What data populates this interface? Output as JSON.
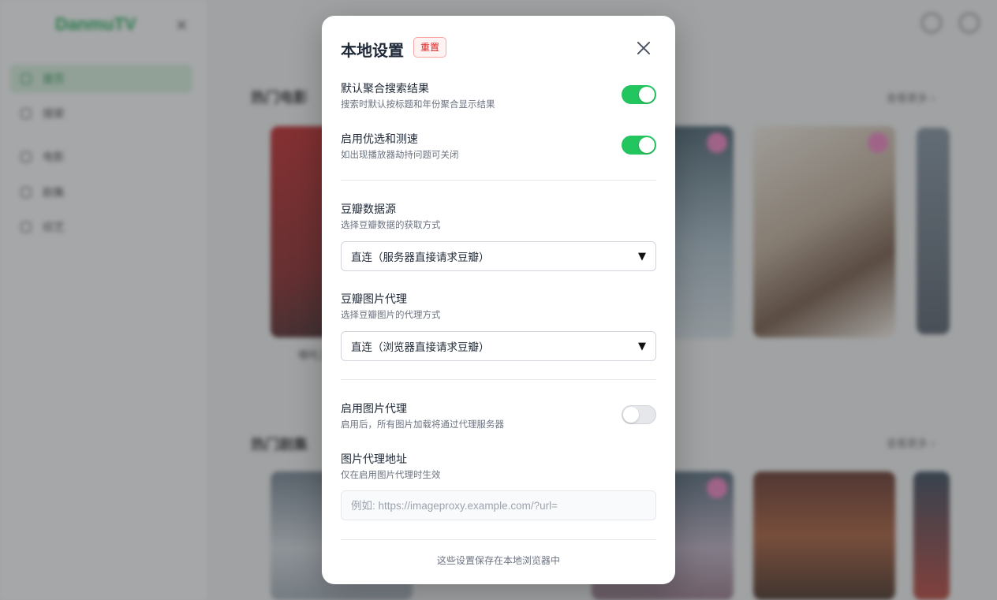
{
  "app": {
    "logo": "DanmuTV"
  },
  "sidebar": {
    "items": [
      {
        "label": "首页",
        "active": true
      },
      {
        "label": "搜索",
        "active": false
      },
      {
        "label": "电影",
        "active": false
      },
      {
        "label": "剧集",
        "active": false
      },
      {
        "label": "综艺",
        "active": false
      }
    ]
  },
  "sections": {
    "movies": {
      "title": "热门电影",
      "more": "查看更多 ›"
    },
    "series": {
      "title": "热门剧集",
      "more": "查看更多 ›"
    }
  },
  "posters_row1_caption": "哪吒之魔",
  "modal": {
    "title": "本地设置",
    "reset_label": "重置",
    "settings": {
      "aggregate": {
        "label": "默认聚合搜索结果",
        "desc": "搜索时默认按标题和年份聚合显示结果",
        "enabled": true
      },
      "speedtest": {
        "label": "启用优选和测速",
        "desc": "如出现播放器劫持问题可关闭",
        "enabled": true
      },
      "douban_source": {
        "label": "豆瓣数据源",
        "desc": "选择豆瓣数据的获取方式",
        "value": "直连（服务器直接请求豆瓣）"
      },
      "douban_image": {
        "label": "豆瓣图片代理",
        "desc": "选择豆瓣图片的代理方式",
        "value": "直连（浏览器直接请求豆瓣）"
      },
      "image_proxy": {
        "label": "启用图片代理",
        "desc": "启用后，所有图片加载将通过代理服务器",
        "enabled": false
      },
      "image_proxy_url": {
        "label": "图片代理地址",
        "desc": "仅在启用图片代理时生效",
        "value": "",
        "placeholder": "例如: https://imageproxy.example.com/?url="
      }
    },
    "footer": "这些设置保存在本地浏览器中"
  },
  "colors": {
    "accent": "#22c55e",
    "danger": "#dc2626"
  }
}
